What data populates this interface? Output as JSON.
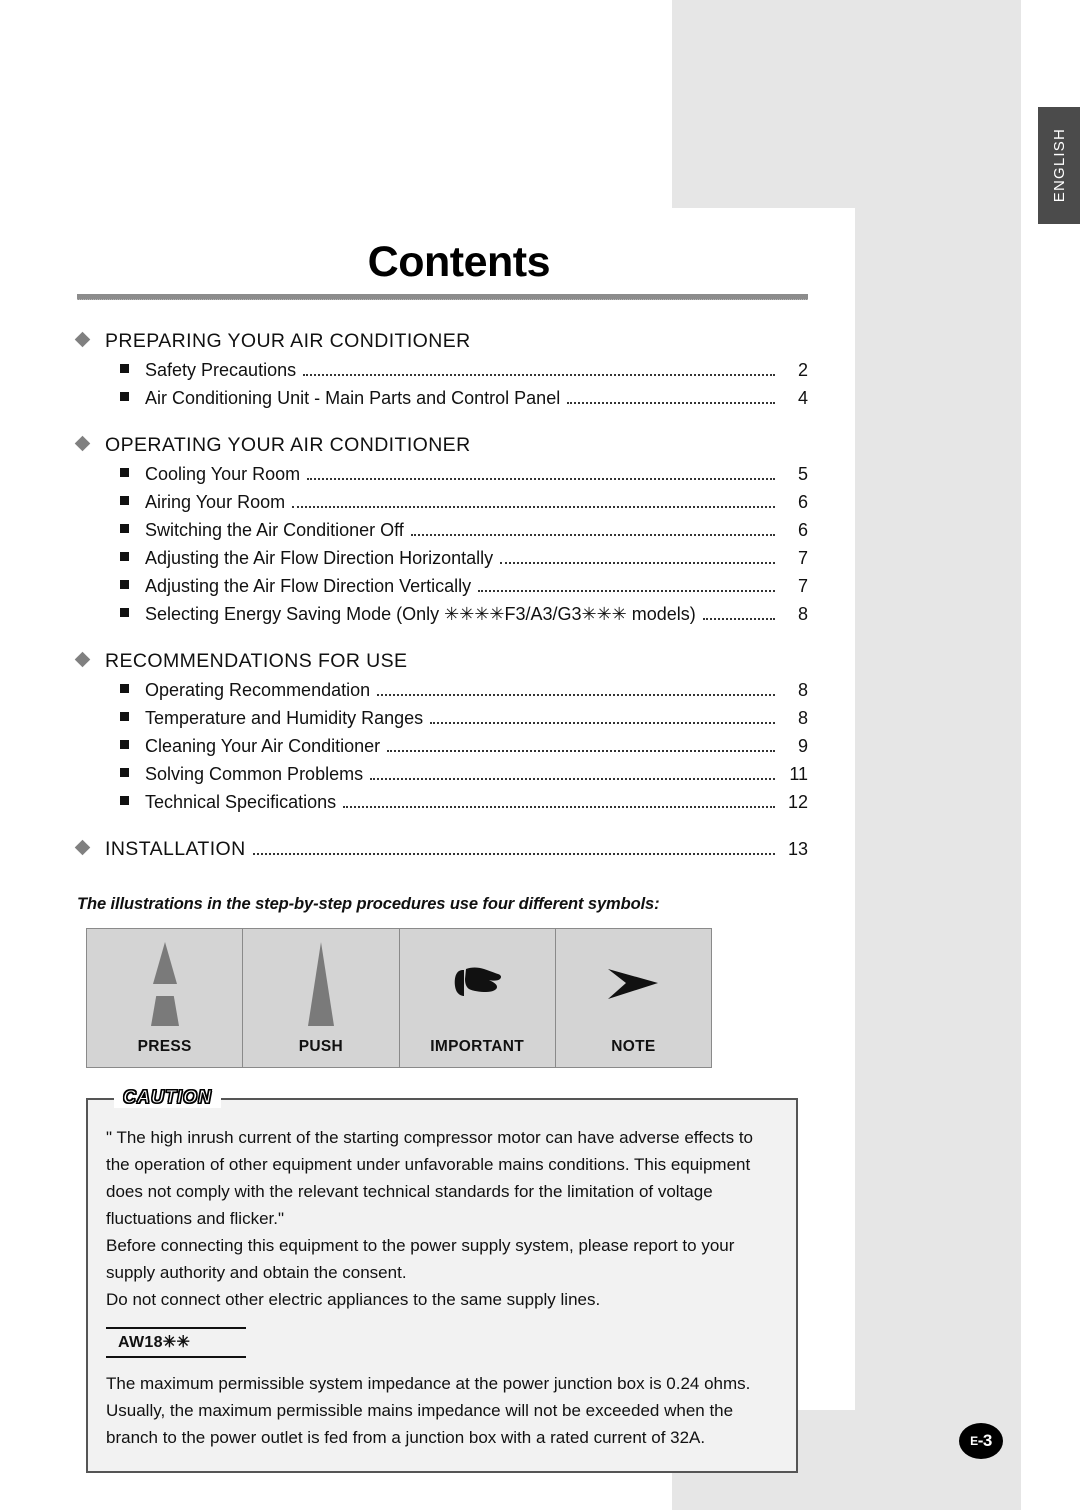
{
  "side_tab": {
    "label": "ENGLISH"
  },
  "page_badge": {
    "prefix": "E",
    "number": "-3",
    "full": "E-3"
  },
  "header": {
    "title": "Contents"
  },
  "toc": {
    "sections": [
      {
        "label": "PREPARING YOUR AIR CONDITIONER",
        "page": "",
        "items": [
          {
            "label": "Safety Precautions",
            "page": "2"
          },
          {
            "label": "Air Conditioning Unit - Main Parts and Control Panel",
            "page": "4"
          }
        ]
      },
      {
        "label": "OPERATING YOUR AIR CONDITIONER",
        "page": "",
        "items": [
          {
            "label": "Cooling Your Room",
            "page": "5"
          },
          {
            "label": "Airing Your Room",
            "page": "6"
          },
          {
            "label": "Switching the Air Conditioner Off",
            "page": "6"
          },
          {
            "label": "Adjusting the Air Flow Direction Horizontally",
            "page": "7"
          },
          {
            "label": "Adjusting the Air Flow Direction Vertically",
            "page": "7"
          },
          {
            "label": "Selecting Energy Saving Mode (Only ✳✳✳✳F3/A3/G3✳✳✳ models)",
            "page": "8"
          }
        ]
      },
      {
        "label": "RECOMMENDATIONS FOR USE",
        "page": "",
        "items": [
          {
            "label": "Operating Recommendation",
            "page": "8"
          },
          {
            "label": "Temperature and Humidity Ranges",
            "page": "8"
          },
          {
            "label": "Cleaning Your Air Conditioner",
            "page": "9"
          },
          {
            "label": "Solving Common Problems",
            "page": "11"
          },
          {
            "label": "Technical Specifications",
            "page": "12"
          }
        ]
      },
      {
        "label": "INSTALLATION",
        "page": "13",
        "items": []
      }
    ]
  },
  "symbols": {
    "intro": "The illustrations in the step-by-step procedures use four different symbols:",
    "cells": [
      {
        "label": "PRESS",
        "icon": "press-triangle-split-icon"
      },
      {
        "label": "PUSH",
        "icon": "push-triangle-icon"
      },
      {
        "label": "IMPORTANT",
        "icon": "pointing-hand-icon"
      },
      {
        "label": "NOTE",
        "icon": "arrowhead-icon"
      }
    ]
  },
  "caution": {
    "label": "CAUTION",
    "paragraphs": [
      "\" The high inrush current of the starting compressor motor can have adverse effects to the operation of other equipment under unfavorable mains conditions. This equipment does not comply with the relevant technical standards for the limitation of voltage fluctuations and flicker.\"",
      "Before connecting this equipment to the power supply system, please report to your supply authority and obtain the consent.",
      "Do not connect other electric appliances to the same supply lines."
    ],
    "model_tag": "AW18✳✳",
    "impedance_text": "The maximum permissible system impedance at the power junction box is 0.24 ohms. Usually, the maximum permissible mains impedance will not be exceeded when the branch to the power outlet is fed from a junction box with a rated current of 32A."
  },
  "colors": {
    "band_gray": "#e6e6e6",
    "tab_gray": "#4b4b4b",
    "rule_gray": "#8c8c8c",
    "symbol_fill": "#d4d4d4",
    "symbol_art": "#7a7a7a",
    "caution_bg": "#f2f2f2"
  }
}
